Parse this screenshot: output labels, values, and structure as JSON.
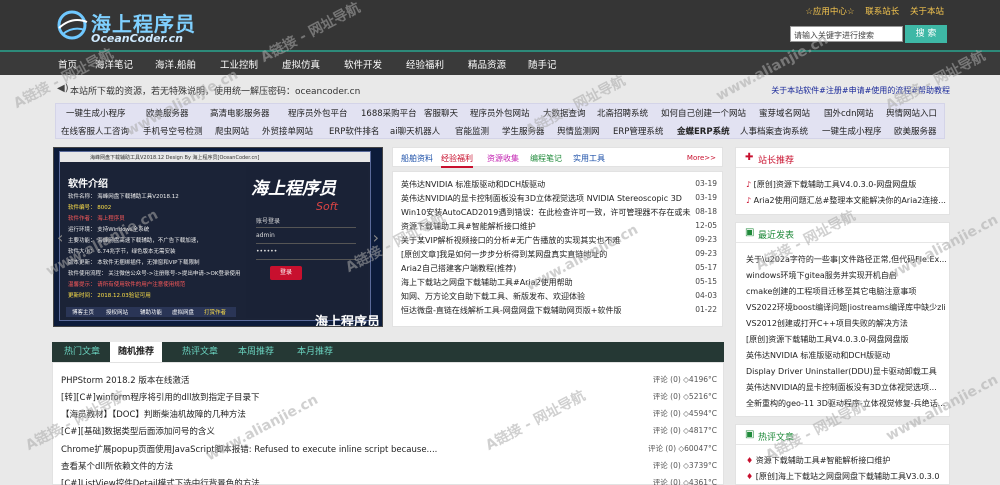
{
  "header": {
    "logo_title": "海上程序员",
    "logo_sub": "OceanCoder.cn",
    "top_links": [
      "☆应用中心☆",
      "联系站长",
      "关于本站"
    ],
    "search_placeholder": "请输入关键字进行搜索",
    "search_button": "搜 索"
  },
  "nav": [
    "首页",
    "海洋笔记",
    "海洋.船舶",
    "工业控制",
    "虚拟仿真",
    "软件开发",
    "经验福利",
    "精品资源",
    "随手记"
  ],
  "notice": {
    "text": "本站所下载的资源，若无特殊说明，使用统一解压密码：oceancoder.cn",
    "right": "关于本站软件#注册#申请#使用的流程#帮助教程"
  },
  "quick_links": {
    "row1": [
      "一键生成小程序",
      "欧美服务器",
      "高清电影服务器",
      "程序员外包平台",
      "1688采购平台",
      "客服聊天",
      "程序员外包网站",
      "大数据查询",
      "北斋招聘系统",
      "如何自己创建一个网站",
      "蜜芽域名网站",
      "国外cdn网站",
      "舆情网站入口"
    ],
    "row2": [
      "在线客服人工咨询",
      "手机号空号检测",
      "爬虫网站",
      "外贸接单网站",
      "ERP软件排名",
      "ai聊天机器人",
      "官能监测",
      "学生服务器",
      "舆情监测网",
      "ERP管理系统",
      "金蝶ERP系统",
      "人事档案查询系统",
      "一键生成小程序",
      "欧美服务器"
    ]
  },
  "slider": {
    "win_title": "海峰网盘下载辅助工具V2018.12   Design By 海上程序员[OceanCoder.cn]",
    "intro_title": "软件介绍",
    "intro_lines": [
      {
        "text": "软件名称： 海峰网盘下载辅助工具V2018.12",
        "style": ""
      },
      {
        "text": "软件编号： 8002",
        "style": "y"
      },
      {
        "text": "软件作者： 海上程序员",
        "style": "r"
      },
      {
        "text": "运行环境： 支持Windows全系统",
        "style": ""
      },
      {
        "text": "主要功能： 海峰网盘高速下载辅助，不广告下载加速，",
        "style": ""
      },
      {
        "text": "软件大小： 6.74兆字节，绿色版本无需安装",
        "style": ""
      },
      {
        "text": "版本更新： 本软件无捆绑插件，无弹窗和VIP下载限制",
        "style": ""
      },
      {
        "text": "软件使用流程： 关注微信公众号->注册账号->提出申请->OK登录使用",
        "style": ""
      },
      {
        "text": "温馨提示： 请所有使用软件的用户注意使用规范",
        "style": "r"
      },
      {
        "text": "更新时间： 2018.12.03验证可用",
        "style": "y"
      }
    ],
    "win_tabs": [
      "博客主页",
      "授权网站",
      "辅助功能",
      "虚拟网盘",
      "打赏作者"
    ],
    "soft_logo": "海上程序员",
    "soft_sub": "Soft",
    "fields": [
      "账号登录",
      "admin",
      "••••••"
    ],
    "login_btn": "登录",
    "footer_logo": "海上程序员"
  },
  "news_tabs": [
    "船舶资料",
    "经验福利",
    "资源收集",
    "编程笔记",
    "实用工具"
  ],
  "news_more": "More>>",
  "news": [
    {
      "title": "英伟达NVIDIA 标准版驱动和DCH版驱动",
      "date": "03-19"
    },
    {
      "title": "英伟达NVIDIA的显卡控制面板没有3D立体视觉选项 NVIDIA Stereoscopic 3D",
      "date": "03-19"
    },
    {
      "title": "Win10安装AutoCAD2019遇到错误：在此检查许可一致，许可管理器不存在或未正常",
      "date": "08-18"
    },
    {
      "title": "资源下载辅助工具#智能解析接口维护",
      "date": "12-05"
    },
    {
      "title": "关于某VIP解析视频接口的分析#无广告播放的实现其实也不难",
      "date": "09-23"
    },
    {
      "title": "[原创文章]我是如何一步步分析得到某网盘真实直链地址的",
      "date": "09-23"
    },
    {
      "title": "Aria2自己搭建客户端教程(推荐)",
      "date": "05-17"
    },
    {
      "title": "海上下载站之网盘下载辅助工具#Aria2使用帮助",
      "date": "05-15"
    },
    {
      "title": "知网、万方论文自助下载工具、新版发布、欢迎体验",
      "date": "04-03"
    },
    {
      "title": "恒达微盘-直链在线解析工具-网盘网盘下载辅助网页版+软件版",
      "date": "01-22"
    }
  ],
  "sidebar": {
    "recommend": {
      "title": "站长推荐",
      "items": [
        "[原创]资源下载辅助工具V4.0.3.0-网盘网盘版",
        "Aria2使用问题汇总#整理本文能解决你的Aria2连接..."
      ]
    },
    "latest": {
      "title": "最近发表",
      "items": [
        "关于\\u202a字符的一些事|文件路径正常,但代码Fle.Ex...",
        "windows环境下gitea服务并实现开机自启",
        "cmake创建的工程项目迁移至其它电脑注意事项",
        "VS2022环境boost编译问题|iostreams编译库中缺少zli...",
        "VS2012创建或打开C++项目失败的解决方法",
        "[原创]资源下载辅助工具V4.0.3.0-网盘网盘版",
        "英伟达NVIDIA 标准版驱动和DCH版驱动",
        "Display Driver Uninstaller(DDU)显卡驱动卸载工具",
        "英伟达NVIDIA的显卡控制面板没有3D立体视觉选项...",
        "全新重构的geo-11 3D驱动程序-立体视觉修复-兵绝话..."
      ]
    },
    "hot": {
      "title": "热评文章",
      "items": [
        "资源下载辅助工具#智能解析接口维护",
        "[原创]海上下载站之网盘网盘下载辅助工具V3.0.3.0"
      ]
    }
  },
  "tabs2": [
    "热门文章",
    "随机推荐",
    "热评文章",
    "本周推荐",
    "本月推荐"
  ],
  "articles": [
    {
      "title": "PHPStorm 2018.2 版本在线激活",
      "meta": "评论 (0) ◇4196°C"
    },
    {
      "title": "[转][C#]winform程序将引用的dll放到指定子目录下",
      "meta": "评论 (0) ◇5216°C"
    },
    {
      "title": "【海员教材】【DOC】判断柴油机故障的几种方法",
      "meta": "评论 (0) ◇4594°C"
    },
    {
      "title": "[C#][基础]数据类型后面添加问号的含义",
      "meta": "评论 (0) ◇4817°C"
    },
    {
      "title": "Chrome扩展popup页面使用JavaScript脚本报错: Refused to execute inline script because....",
      "meta": "评论 (0) ◇60047°C"
    },
    {
      "title": "查看某个dll所依赖文件的方法",
      "meta": "评论 (0) ◇3739°C"
    },
    {
      "title": "[C#]ListView控件Detail模式下选中行背景色的方法",
      "meta": "评论 (0) ◇4361°C"
    }
  ],
  "watermark": "A链接 - 网址导航",
  "watermark_url": "www.alianjie.cn",
  "colors": {
    "accent": "#3eb8a6",
    "nav_bg": "#3a3a3a",
    "header_bg": "#353535",
    "link_blue": "#1b2a9a",
    "red": "#c8102e"
  }
}
